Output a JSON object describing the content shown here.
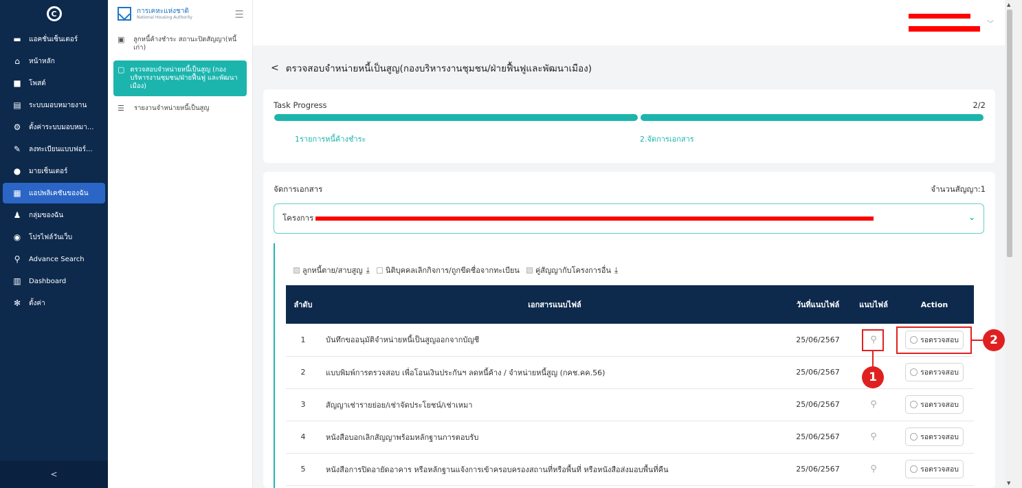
{
  "sidebar": {
    "items": [
      {
        "label": "แอคชั่นเซ็นเตอร์",
        "icon": "inbox-icon"
      },
      {
        "label": "หน้าหลัก",
        "icon": "home-icon"
      },
      {
        "label": "โพสต์",
        "icon": "post-icon"
      },
      {
        "label": "ระบบมอบหมายงาน",
        "icon": "assignment-icon"
      },
      {
        "label": "ตั้งค่าระบบมอบหมา...",
        "icon": "gear-icon"
      },
      {
        "label": "ลงทะเบียนแบบฟอร์...",
        "icon": "form-icon"
      },
      {
        "label": "มายเซ็นเตอร์",
        "icon": "user-icon"
      },
      {
        "label": "แอปพลิเคชันของฉัน",
        "icon": "apps-icon"
      },
      {
        "label": "กลุ่มของฉัน",
        "icon": "group-icon"
      },
      {
        "label": "โปรไฟล์วันเว็บ",
        "icon": "profile-icon"
      },
      {
        "label": "Advance Search",
        "icon": "search-icon"
      },
      {
        "label": "Dashboard",
        "icon": "chart-icon"
      },
      {
        "label": "ตั้งค่า",
        "icon": "settings-icon"
      }
    ],
    "collapse": "<"
  },
  "panel": {
    "brand_title": "การเคหะแห่งชาติ",
    "brand_sub": "National Housing Authority",
    "items": [
      {
        "label": "ลูกหนี้ค้างชำระ สถานะปิดสัญญา(หนี้เก่า)"
      },
      {
        "label": "ตรวจสอบจำหน่ายหนี้เป็นสูญ (กองบริหารงานชุมชน/ฝ่ายฟื้นฟู และพัฒนาเมือง)"
      },
      {
        "label": "รายงานจำหน่ายหนี้เป็นสูญ"
      }
    ]
  },
  "page": {
    "title": "ตรวจสอบจำหน่ายหนี้เป็นสูญ(กองบริหารงานชุมชน/ฝ่ายฟื้นฟูและพัฒนาเมือง)",
    "back": "<"
  },
  "progress": {
    "label": "Task Progress",
    "count": "2/2",
    "steps": [
      "1รายการหนี้ค้างชำระ",
      "2.จัดการเอกสาร"
    ],
    "completed_fraction": 1.0
  },
  "docs": {
    "title": "จัดการเอกสาร",
    "contract_count": "จำนวนสัญญา:1",
    "project_label": "โครงการ :",
    "legend": [
      "ลูกหนี้ตาย/สาบสูญ",
      "นิติบุคคลเลิกกิจการ/ถูกขีดชื่อจากทะเบียน",
      "คู่สัญญากับโครงการอื่น"
    ],
    "columns": [
      "ลำดับ",
      "เอกสารแนบไฟล์",
      "วันที่แนบไฟล์",
      "แนบไฟล์",
      "Action"
    ],
    "rows": [
      {
        "no": "1",
        "doc": "บันทึกขออนุมัติจำหน่ายหนี้เป็นสูญออกจากบัญชี",
        "date": "25/06/2567",
        "action": "รอตรวจสอบ"
      },
      {
        "no": "2",
        "doc": "แบบพิมพ์การตรวจสอบ เพื่อโอนเงินประกันฯ ลดหนี้ค้าง / จำหน่ายหนี้สูญ (กคช.คค.56)",
        "date": "25/06/2567",
        "action": "รอตรวจสอบ"
      },
      {
        "no": "3",
        "doc": "สัญญาเช่ารายย่อย/เช่าจัดประโยชน์/เช่าเหมา",
        "date": "25/06/2567",
        "action": "รอตรวจสอบ"
      },
      {
        "no": "4",
        "doc": "หนังสือบอกเลิกสัญญาพร้อมหลักฐานการตอบรับ",
        "date": "25/06/2567",
        "action": "รอตรวจสอบ"
      },
      {
        "no": "5",
        "doc": "หนังสือการปิดอายัดอาคาร หรือหลักฐานแจ้งการเข้าครอบครองสถานที่หรือพื้นที่ หรือหนังสือส่งมอบพื้นที่คืน",
        "date": "25/06/2567",
        "action": "รอตรวจสอบ"
      }
    ]
  },
  "annotations": {
    "badge1": "1",
    "badge2": "2"
  },
  "colors": {
    "sidebar": "#0d2a4d",
    "accent": "#1cb5ae",
    "annotation": "#e02020"
  }
}
